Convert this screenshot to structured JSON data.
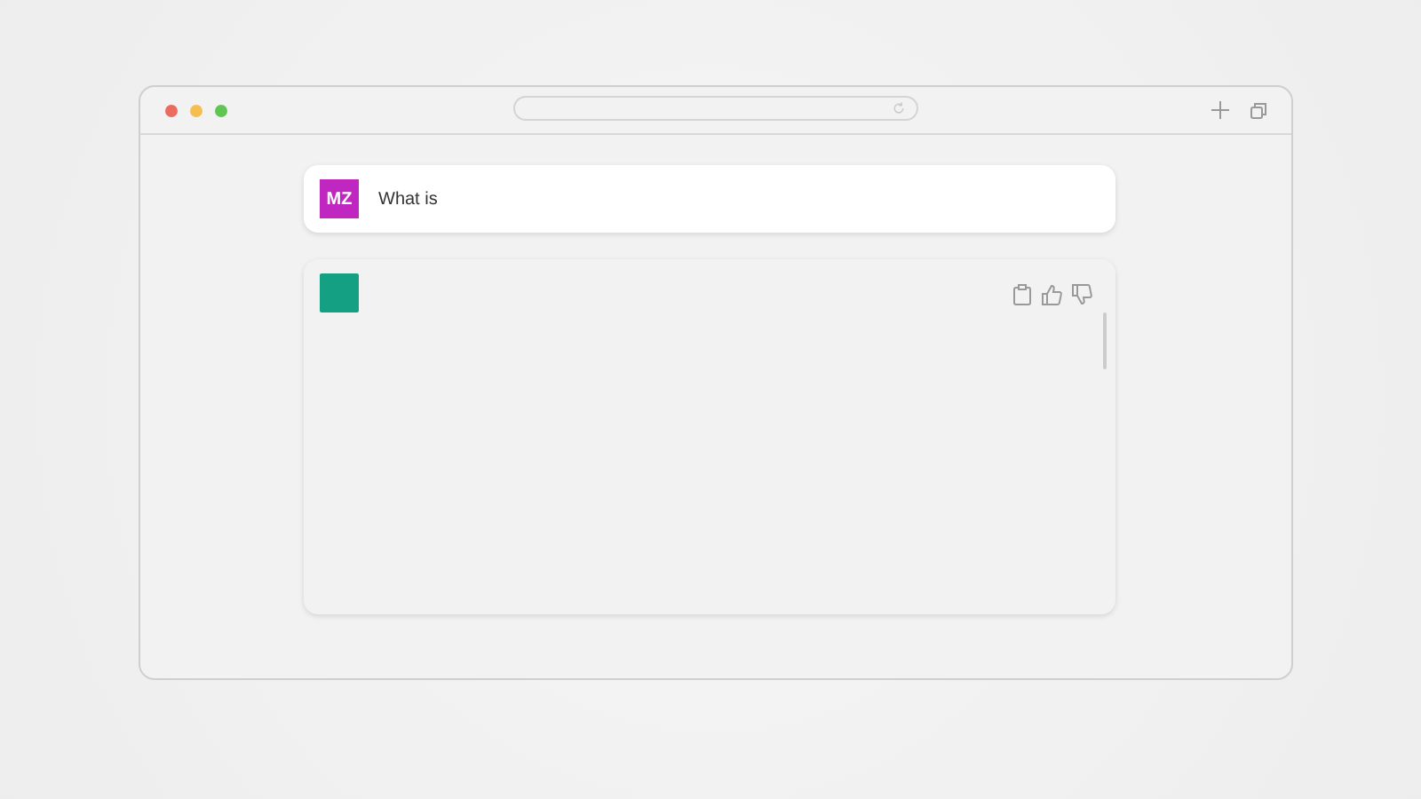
{
  "user_message": {
    "avatar": "MZ",
    "text": "What is"
  }
}
